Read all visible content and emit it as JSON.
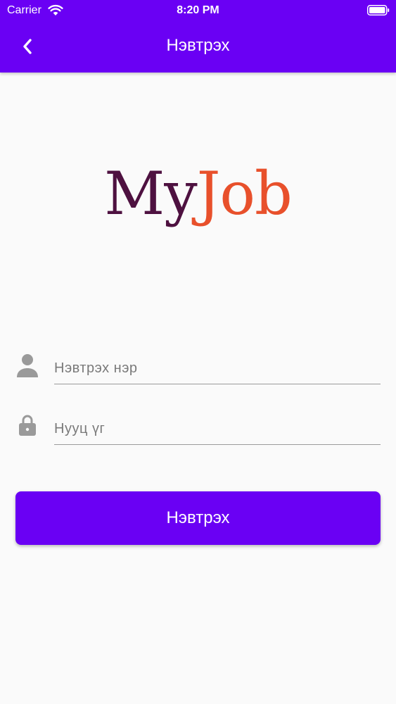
{
  "status_bar": {
    "carrier": "Carrier",
    "time": "8:20 PM",
    "wifi_icon": "wifi-icon",
    "battery_icon": "battery-icon"
  },
  "app_bar": {
    "title": "Нэвтрэх",
    "back_icon": "chevron-left-icon",
    "background_color": "#6a00f4"
  },
  "logo": {
    "part1": "My",
    "part2": "Job",
    "part1_color": "#4e1140",
    "part2_color": "#e8502b"
  },
  "form": {
    "username": {
      "placeholder": "Нэвтрэх нэр",
      "value": "",
      "icon": "person-icon"
    },
    "password": {
      "placeholder": "Нууц үг",
      "value": "",
      "icon": "lock-icon"
    },
    "submit_label": "Нэвтрэх",
    "icon_color": "#9a9a9a"
  }
}
